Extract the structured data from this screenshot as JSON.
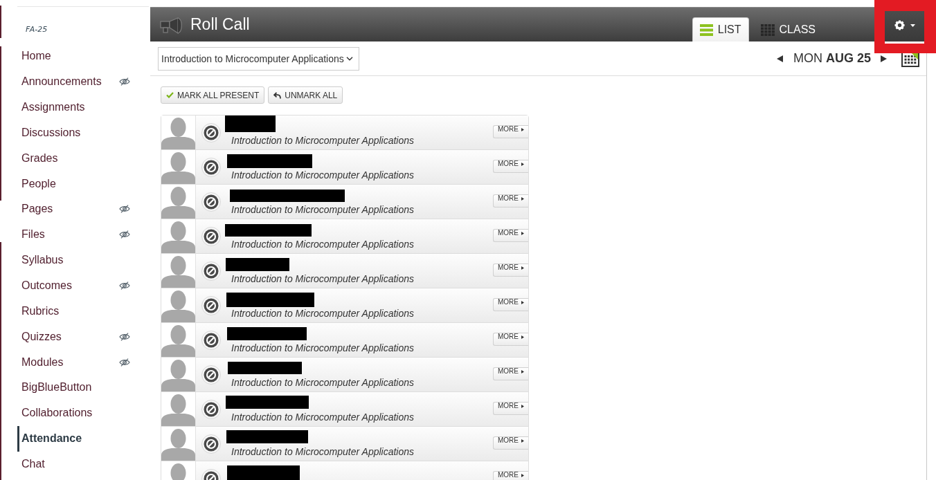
{
  "sidebar": {
    "term": "FA-25",
    "items": [
      {
        "label": "Home",
        "hidden": false,
        "selected": false
      },
      {
        "label": "Announcements",
        "hidden": true,
        "selected": false
      },
      {
        "label": "Assignments",
        "hidden": false,
        "selected": false
      },
      {
        "label": "Discussions",
        "hidden": false,
        "selected": false
      },
      {
        "label": "Grades",
        "hidden": false,
        "selected": false
      },
      {
        "label": "People",
        "hidden": false,
        "selected": false
      },
      {
        "label": "Pages",
        "hidden": true,
        "selected": false
      },
      {
        "label": "Files",
        "hidden": true,
        "selected": false
      },
      {
        "label": "Syllabus",
        "hidden": false,
        "selected": false
      },
      {
        "label": "Outcomes",
        "hidden": true,
        "selected": false
      },
      {
        "label": "Rubrics",
        "hidden": false,
        "selected": false
      },
      {
        "label": "Quizzes",
        "hidden": true,
        "selected": false
      },
      {
        "label": "Modules",
        "hidden": true,
        "selected": false
      },
      {
        "label": "BigBlueButton",
        "hidden": false,
        "selected": false
      },
      {
        "label": "Collaborations",
        "hidden": false,
        "selected": false
      },
      {
        "label": "Attendance",
        "hidden": false,
        "selected": true
      },
      {
        "label": "Chat",
        "hidden": false,
        "selected": false
      }
    ]
  },
  "header": {
    "title": "Roll Call",
    "tabs": [
      {
        "label": "LIST",
        "kind": "list",
        "selected": true
      },
      {
        "label": "CLASS",
        "kind": "grid",
        "selected": false
      }
    ],
    "settings": {
      "highlighted": true
    }
  },
  "date_bar": {
    "course_select": {
      "value": "Introduction to Microcomputer Applications"
    },
    "date": "MON **AUG 25**"
  },
  "actions": [
    {
      "label": "MARK ALL PRESENT",
      "kind": "check"
    },
    {
      "label": "UNMARK ALL",
      "kind": "undo"
    }
  ],
  "students": [
    {
      "marked": false,
      "course": "Introduction to Microcomputer Applications",
      "more": "MORE"
    },
    {
      "marked": false,
      "course": "Introduction to Microcomputer Applications",
      "more": "MORE"
    },
    {
      "marked": false,
      "course": "Introduction to Microcomputer Applications",
      "more": "MORE"
    },
    {
      "marked": false,
      "course": "Introduction to Microcomputer Applications",
      "more": "MORE"
    },
    {
      "marked": false,
      "course": "Introduction to Microcomputer Applications",
      "more": "MORE"
    },
    {
      "marked": false,
      "course": "Introduction to Microcomputer Applications",
      "more": "MORE"
    },
    {
      "marked": false,
      "course": "Introduction to Microcomputer Applications",
      "more": "MORE"
    },
    {
      "marked": false,
      "course": "Introduction to Microcomputer Applications",
      "more": "MORE"
    },
    {
      "marked": false,
      "course": "Introduction to Microcomputer Applications",
      "more": "MORE"
    },
    {
      "marked": false,
      "course": "Introduction to Microcomputer Applications",
      "more": "MORE"
    },
    {
      "marked": false,
      "more": "MORE"
    }
  ]
}
